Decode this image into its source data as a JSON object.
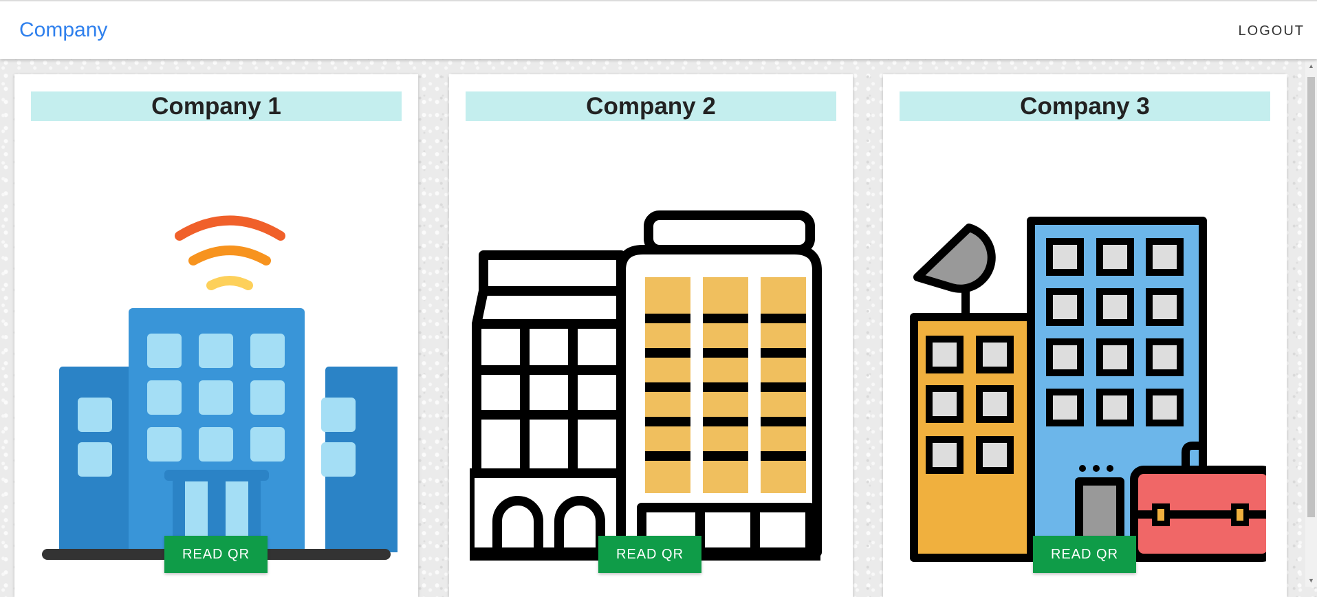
{
  "navbar": {
    "brand": "Company",
    "logout_label": "LOGOUT"
  },
  "cards": [
    {
      "title": "Company 1",
      "button_label": "READ QR",
      "icon": "office-building-wifi-icon"
    },
    {
      "title": "Company 2",
      "button_label": "READ QR",
      "icon": "city-buildings-outline-icon"
    },
    {
      "title": "Company 3",
      "button_label": "READ QR",
      "icon": "business-buildings-briefcase-icon"
    }
  ],
  "colors": {
    "brand_link": "#2f80ed",
    "title_band": "#c4eeee",
    "button": "#0f9c48"
  }
}
